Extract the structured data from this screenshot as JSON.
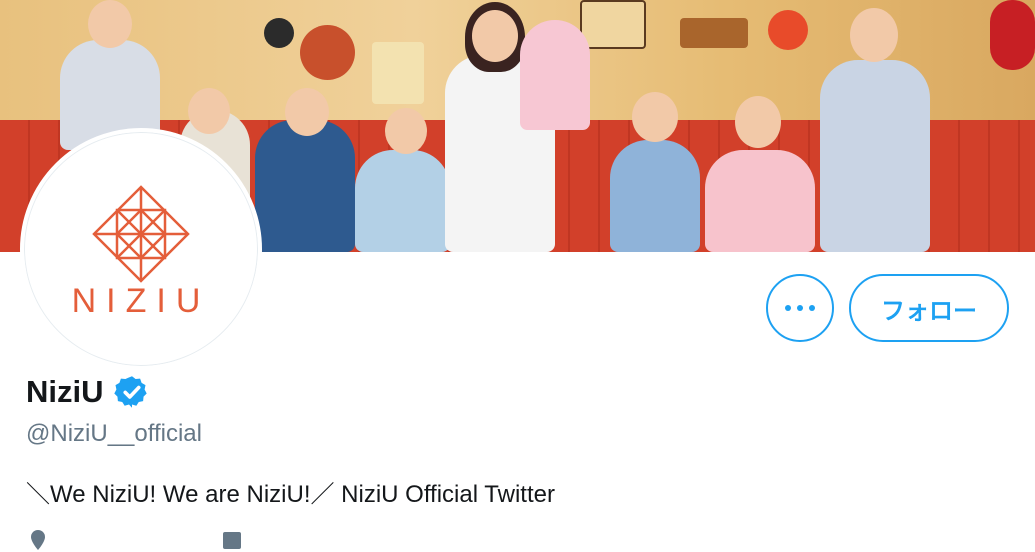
{
  "banner": {
    "description_icon": "group-photo-banner"
  },
  "avatar": {
    "logo_text": "NIZIU",
    "logo_icon": "niziu-diamond-logo-icon"
  },
  "actions": {
    "more_icon": "more-dots-icon",
    "follow_label": "フォロー"
  },
  "profile": {
    "display_name": "NiziU",
    "verified_icon": "verified-badge-icon",
    "handle": "@NiziU__official",
    "bio": "＼We NiziU! We are NiziU!／ NiziU Official Twitter",
    "location_icon": "location-pin-icon",
    "calendar_icon": "calendar-icon"
  },
  "colors": {
    "accent": "#1da1f2",
    "logo": "#e45e3a",
    "text_secondary": "#657786"
  }
}
